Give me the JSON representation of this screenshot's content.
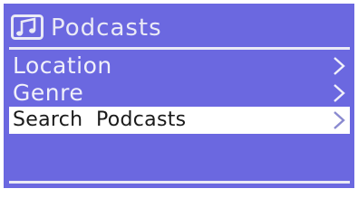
{
  "header": {
    "title": "Podcasts",
    "icon": "music-note-icon"
  },
  "menu": {
    "items": [
      {
        "label": "Location",
        "selected": false
      },
      {
        "label": "Genre",
        "selected": false
      },
      {
        "label": "Search  Podcasts",
        "selected": true
      }
    ]
  },
  "colors": {
    "screen_background": "#6b68e0",
    "text": "#f0f0fa",
    "selected_background": "#ffffff",
    "selected_text": "#1a1a1a"
  }
}
